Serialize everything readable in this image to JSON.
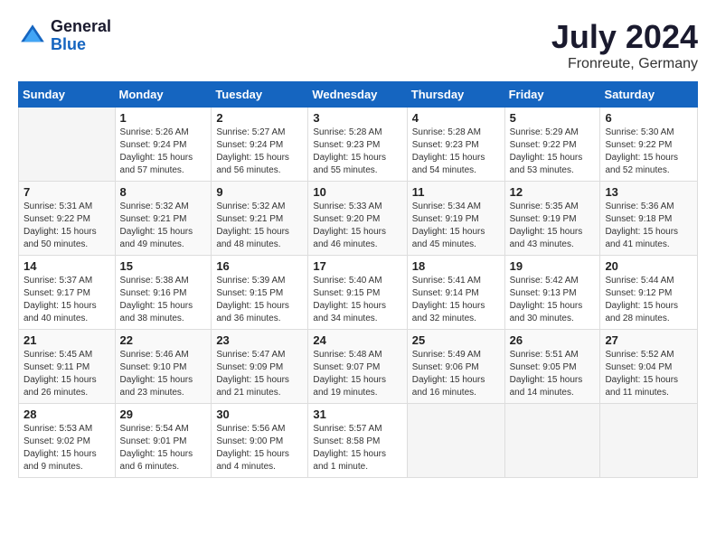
{
  "logo": {
    "line1": "General",
    "line2": "Blue"
  },
  "title": "July 2024",
  "location": "Fronreute, Germany",
  "weekdays": [
    "Sunday",
    "Monday",
    "Tuesday",
    "Wednesday",
    "Thursday",
    "Friday",
    "Saturday"
  ],
  "weeks": [
    [
      {
        "day": "",
        "info": ""
      },
      {
        "day": "1",
        "info": "Sunrise: 5:26 AM\nSunset: 9:24 PM\nDaylight: 15 hours\nand 57 minutes."
      },
      {
        "day": "2",
        "info": "Sunrise: 5:27 AM\nSunset: 9:24 PM\nDaylight: 15 hours\nand 56 minutes."
      },
      {
        "day": "3",
        "info": "Sunrise: 5:28 AM\nSunset: 9:23 PM\nDaylight: 15 hours\nand 55 minutes."
      },
      {
        "day": "4",
        "info": "Sunrise: 5:28 AM\nSunset: 9:23 PM\nDaylight: 15 hours\nand 54 minutes."
      },
      {
        "day": "5",
        "info": "Sunrise: 5:29 AM\nSunset: 9:22 PM\nDaylight: 15 hours\nand 53 minutes."
      },
      {
        "day": "6",
        "info": "Sunrise: 5:30 AM\nSunset: 9:22 PM\nDaylight: 15 hours\nand 52 minutes."
      }
    ],
    [
      {
        "day": "7",
        "info": "Sunrise: 5:31 AM\nSunset: 9:22 PM\nDaylight: 15 hours\nand 50 minutes."
      },
      {
        "day": "8",
        "info": "Sunrise: 5:32 AM\nSunset: 9:21 PM\nDaylight: 15 hours\nand 49 minutes."
      },
      {
        "day": "9",
        "info": "Sunrise: 5:32 AM\nSunset: 9:21 PM\nDaylight: 15 hours\nand 48 minutes."
      },
      {
        "day": "10",
        "info": "Sunrise: 5:33 AM\nSunset: 9:20 PM\nDaylight: 15 hours\nand 46 minutes."
      },
      {
        "day": "11",
        "info": "Sunrise: 5:34 AM\nSunset: 9:19 PM\nDaylight: 15 hours\nand 45 minutes."
      },
      {
        "day": "12",
        "info": "Sunrise: 5:35 AM\nSunset: 9:19 PM\nDaylight: 15 hours\nand 43 minutes."
      },
      {
        "day": "13",
        "info": "Sunrise: 5:36 AM\nSunset: 9:18 PM\nDaylight: 15 hours\nand 41 minutes."
      }
    ],
    [
      {
        "day": "14",
        "info": "Sunrise: 5:37 AM\nSunset: 9:17 PM\nDaylight: 15 hours\nand 40 minutes."
      },
      {
        "day": "15",
        "info": "Sunrise: 5:38 AM\nSunset: 9:16 PM\nDaylight: 15 hours\nand 38 minutes."
      },
      {
        "day": "16",
        "info": "Sunrise: 5:39 AM\nSunset: 9:15 PM\nDaylight: 15 hours\nand 36 minutes."
      },
      {
        "day": "17",
        "info": "Sunrise: 5:40 AM\nSunset: 9:15 PM\nDaylight: 15 hours\nand 34 minutes."
      },
      {
        "day": "18",
        "info": "Sunrise: 5:41 AM\nSunset: 9:14 PM\nDaylight: 15 hours\nand 32 minutes."
      },
      {
        "day": "19",
        "info": "Sunrise: 5:42 AM\nSunset: 9:13 PM\nDaylight: 15 hours\nand 30 minutes."
      },
      {
        "day": "20",
        "info": "Sunrise: 5:44 AM\nSunset: 9:12 PM\nDaylight: 15 hours\nand 28 minutes."
      }
    ],
    [
      {
        "day": "21",
        "info": "Sunrise: 5:45 AM\nSunset: 9:11 PM\nDaylight: 15 hours\nand 26 minutes."
      },
      {
        "day": "22",
        "info": "Sunrise: 5:46 AM\nSunset: 9:10 PM\nDaylight: 15 hours\nand 23 minutes."
      },
      {
        "day": "23",
        "info": "Sunrise: 5:47 AM\nSunset: 9:09 PM\nDaylight: 15 hours\nand 21 minutes."
      },
      {
        "day": "24",
        "info": "Sunrise: 5:48 AM\nSunset: 9:07 PM\nDaylight: 15 hours\nand 19 minutes."
      },
      {
        "day": "25",
        "info": "Sunrise: 5:49 AM\nSunset: 9:06 PM\nDaylight: 15 hours\nand 16 minutes."
      },
      {
        "day": "26",
        "info": "Sunrise: 5:51 AM\nSunset: 9:05 PM\nDaylight: 15 hours\nand 14 minutes."
      },
      {
        "day": "27",
        "info": "Sunrise: 5:52 AM\nSunset: 9:04 PM\nDaylight: 15 hours\nand 11 minutes."
      }
    ],
    [
      {
        "day": "28",
        "info": "Sunrise: 5:53 AM\nSunset: 9:02 PM\nDaylight: 15 hours\nand 9 minutes."
      },
      {
        "day": "29",
        "info": "Sunrise: 5:54 AM\nSunset: 9:01 PM\nDaylight: 15 hours\nand 6 minutes."
      },
      {
        "day": "30",
        "info": "Sunrise: 5:56 AM\nSunset: 9:00 PM\nDaylight: 15 hours\nand 4 minutes."
      },
      {
        "day": "31",
        "info": "Sunrise: 5:57 AM\nSunset: 8:58 PM\nDaylight: 15 hours\nand 1 minute."
      },
      {
        "day": "",
        "info": ""
      },
      {
        "day": "",
        "info": ""
      },
      {
        "day": "",
        "info": ""
      }
    ]
  ]
}
